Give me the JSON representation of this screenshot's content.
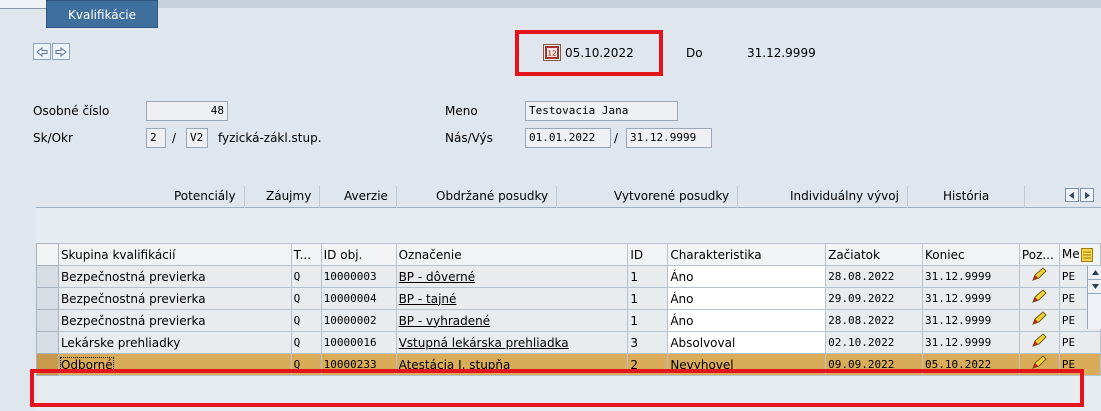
{
  "top": {
    "btn_label": ""
  },
  "date_range": {
    "from": "05.10.2022",
    "to_label": "Do",
    "to": "31.12.9999"
  },
  "header": {
    "osobne_cislo_label": "Osobné číslo",
    "osobne_cislo": "48",
    "sk_okr_label": "Sk/Okr",
    "sk": "2",
    "slash": "/",
    "okr": "V2",
    "okr_text": "fyzická-zákl.stup.",
    "meno_label": "Meno",
    "meno": "Testovacia Jana",
    "nas_vys_label": "Nás/Výs",
    "nas": "01.01.2022",
    "vys": "31.12.9999"
  },
  "tabs": [
    {
      "label": "Kvalifikácie"
    },
    {
      "label": "Potenciály"
    },
    {
      "label": "Záujmy"
    },
    {
      "label": "Averzie"
    },
    {
      "label": "Obdržané posudky"
    },
    {
      "label": "Vytvorené posudky"
    },
    {
      "label": "Individuálny vývoj"
    },
    {
      "label": "História"
    }
  ],
  "table": {
    "headers": [
      "Skupina kvalifikácií",
      "T...",
      "ID obj.",
      "Označenie",
      "ID",
      "Charakteristika",
      "Začiatok",
      "Koniec",
      "Poz...",
      "Me"
    ],
    "rows": [
      {
        "skupina": "Bezpečnostná previerka",
        "t": "Q",
        "id_obj": "10000003",
        "oznacenie": "BP - dôverné",
        "id": "1",
        "char": "Áno",
        "zac": "28.08.2022",
        "kon": "31.12.9999",
        "me": "PE"
      },
      {
        "skupina": "Bezpečnostná previerka",
        "t": "Q",
        "id_obj": "10000004",
        "oznacenie": "BP - tajné",
        "id": "1",
        "char": "Áno",
        "zac": "29.09.2022",
        "kon": "31.12.9999",
        "me": "PE"
      },
      {
        "skupina": "Bezpečnostná previerka",
        "t": "Q",
        "id_obj": "10000002",
        "oznacenie": "BP - vyhradené",
        "id": "1",
        "char": "Áno",
        "zac": "28.08.2022",
        "kon": "31.12.9999",
        "me": "PE"
      },
      {
        "skupina": "Lekárske prehliadky",
        "t": "Q",
        "id_obj": "10000016",
        "oznacenie": "Vstupná lekárska prehliadka",
        "id": "3",
        "char": "Absolvoval",
        "zac": "02.10.2022",
        "kon": "31.12.9999",
        "me": "PE"
      },
      {
        "skupina": "Odborné",
        "t": "Q",
        "id_obj": "10000233",
        "oznacenie": "Atestácia I. stupňa",
        "id": "2",
        "char": "Nevyhovel",
        "zac": "09.09.2022",
        "kon": "05.10.2022",
        "me": "PE"
      }
    ]
  },
  "colors": {
    "highlight_row": "#d9ac5a",
    "red_box": "#e3141b",
    "active_tab": "#3f6f9d"
  }
}
